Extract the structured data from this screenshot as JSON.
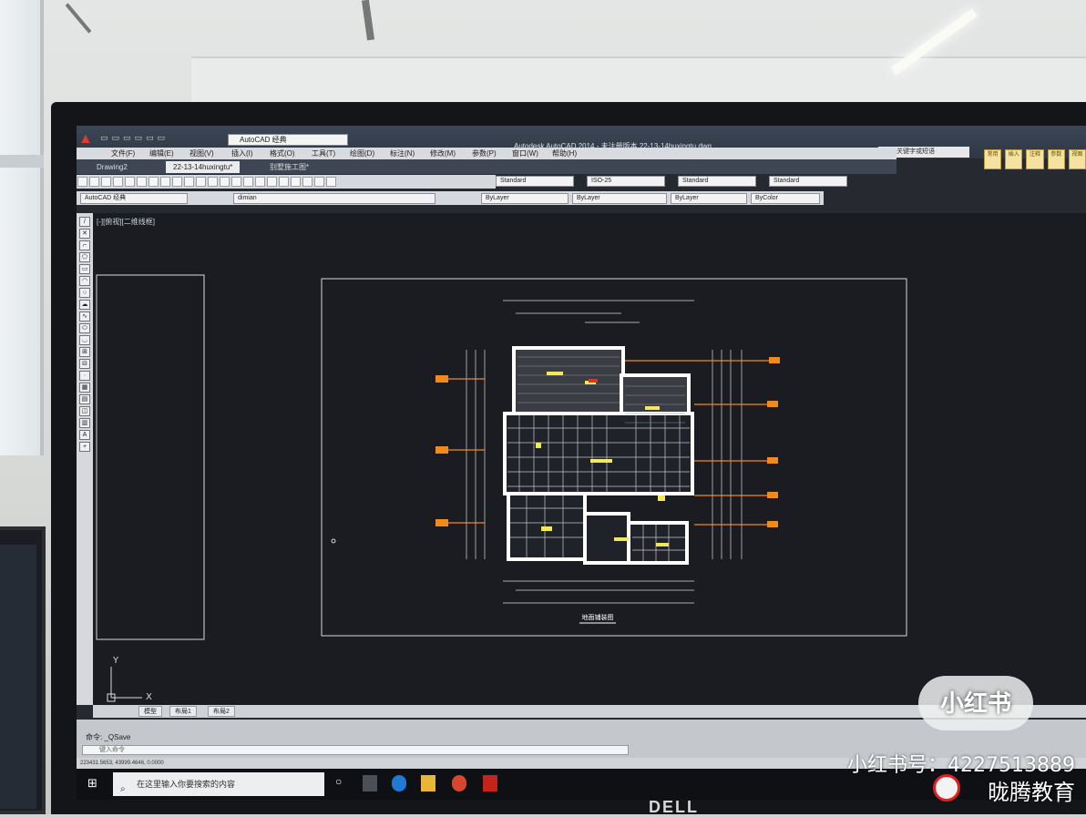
{
  "app": {
    "title": "Autodesk AutoCAD 2014 - 未注册版本     22-13-14huxingtu.dwg",
    "workspace": "AutoCAD 经典",
    "search_placeholder": "键入关键字或短语",
    "ribbon_icons": [
      "常用",
      "插入",
      "注释",
      "参数",
      "视图"
    ]
  },
  "menu": [
    "文件(F)",
    "编辑(E)",
    "视图(V)",
    "插入(I)",
    "格式(O)",
    "工具(T)",
    "绘图(D)",
    "标注(N)",
    "修改(M)",
    "参数(P)",
    "窗口(W)",
    "帮助(H)"
  ],
  "doc_tabs": [
    "Drawing2",
    "22-13-14huxingtu*",
    "别墅施工图*"
  ],
  "toolbar": {
    "workspace_combo": "AutoCAD 经典",
    "layer_combo": "dimian",
    "text_style": "Standard",
    "dim_style": "ISO-25",
    "table_style": "Standard",
    "multileader_style": "Standard",
    "color_combo": "ByLayer",
    "linetype_combo": "ByLayer",
    "lineweight_combo": "ByLayer",
    "plot_style": "ByColor"
  },
  "viewport": {
    "label": "[-][俯视][二维线框]",
    "drawing_title": "地面铺装图",
    "ucs_x": "X",
    "ucs_y": "Y"
  },
  "layout_tabs": [
    "模型",
    "布局1",
    "布局2"
  ],
  "command": {
    "history_line": "命令: _QSave",
    "input_placeholder": "键入命令"
  },
  "status": {
    "coordinates": "223431.5653, 43999.4646, 0.0000"
  },
  "taskbar": {
    "search_placeholder": "在这里输入你要搜索的内容"
  },
  "overlay": {
    "badge": "小红书",
    "xhs_id": "小红书号：4227513889",
    "brand": "昽腾教育",
    "monitor_brand": "DELL"
  }
}
